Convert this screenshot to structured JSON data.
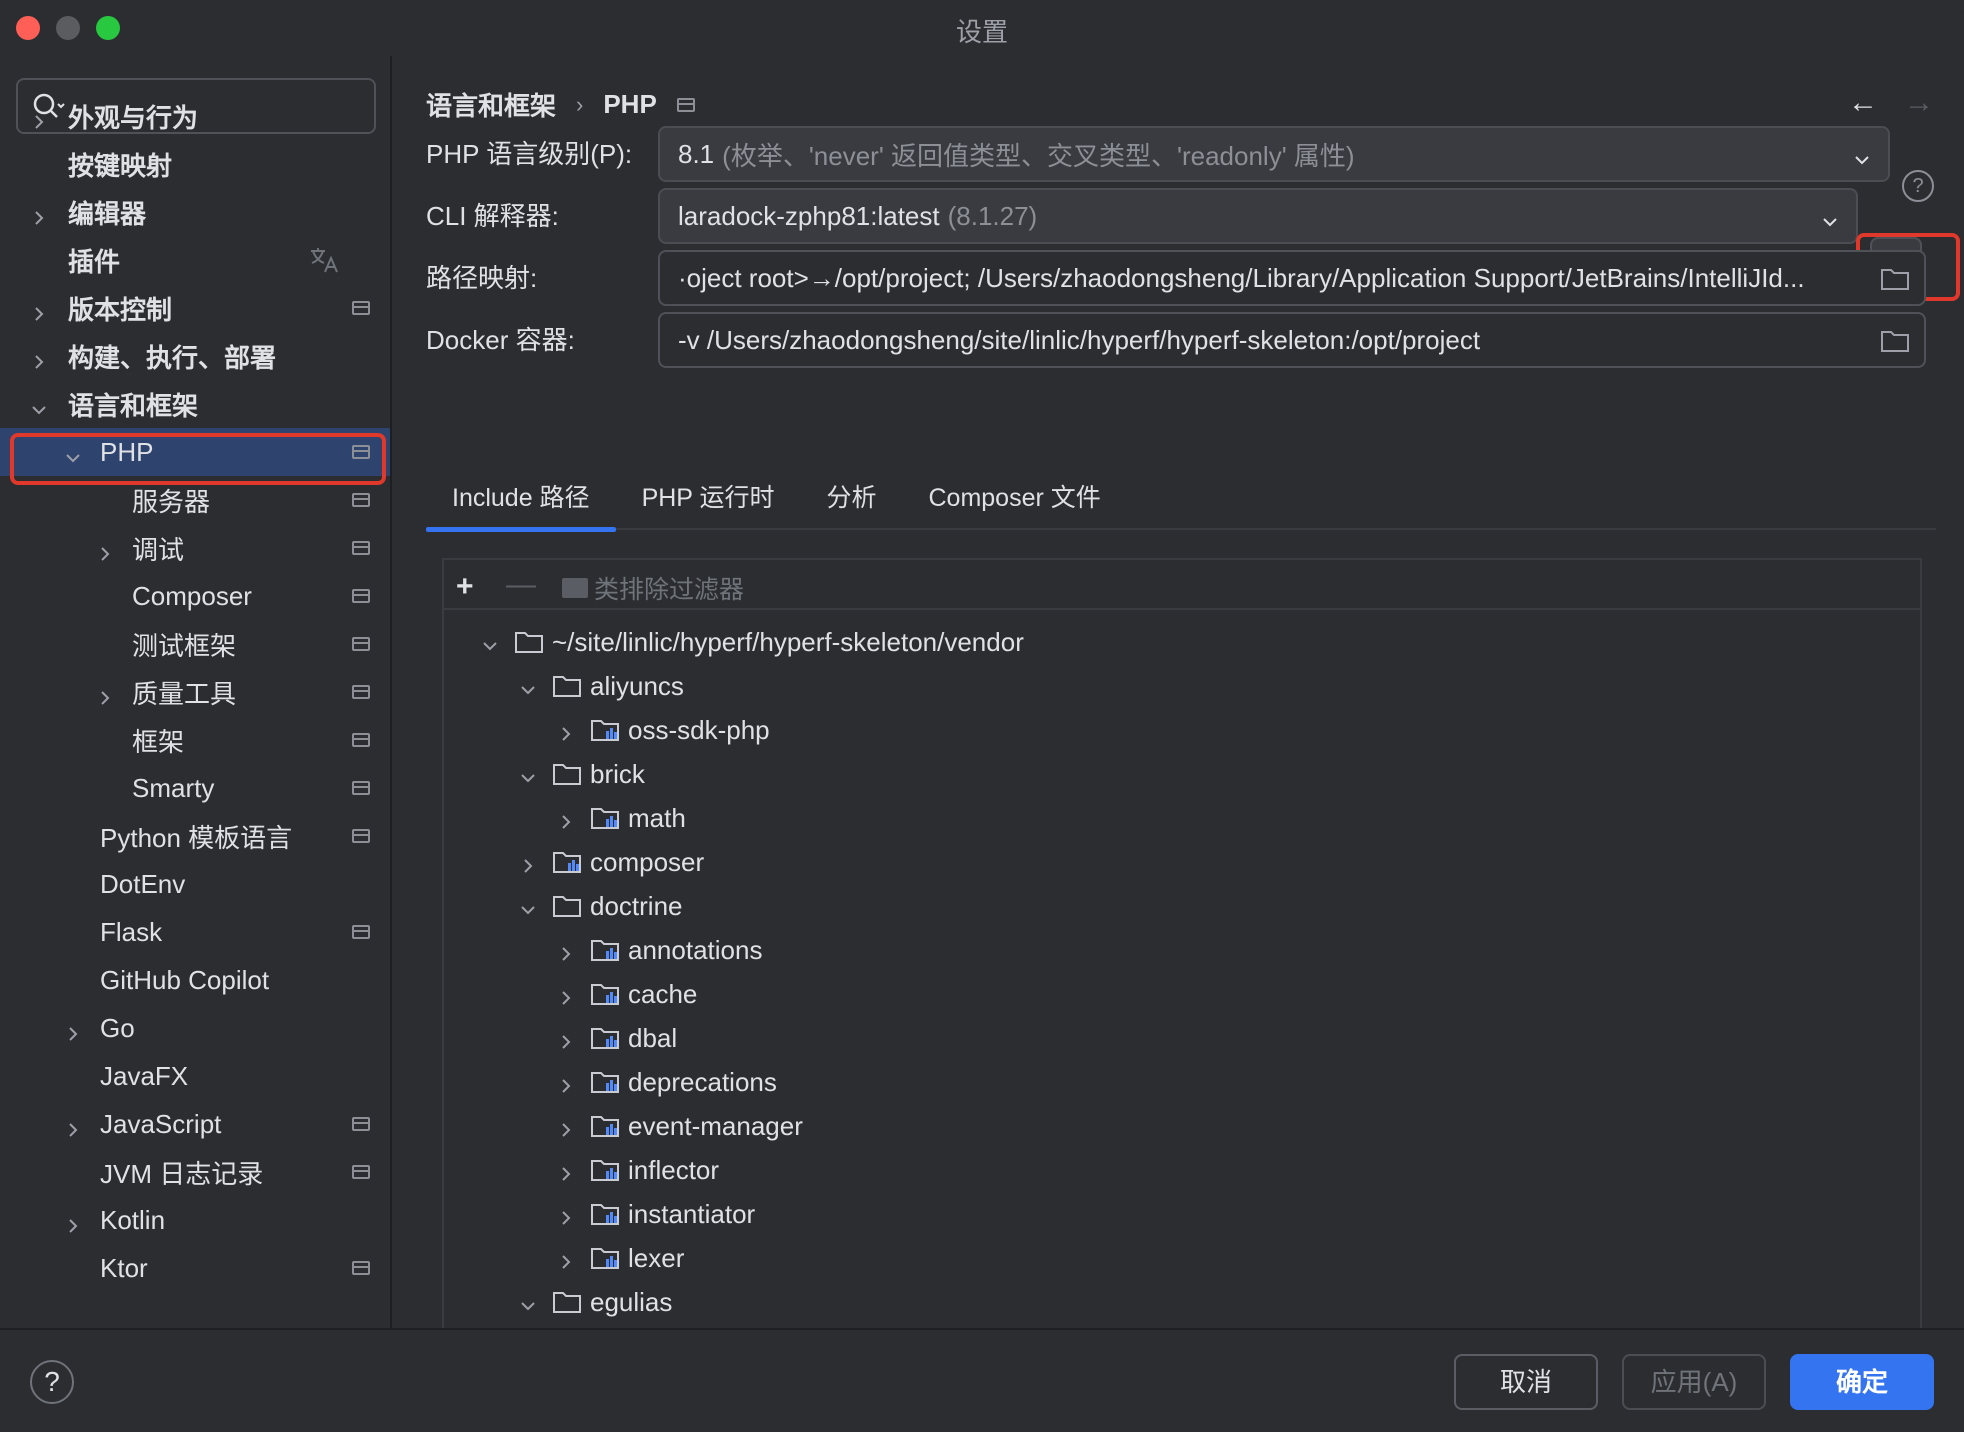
{
  "window": {
    "title": "设置"
  },
  "sidebar": {
    "search": {
      "placeholder": ""
    },
    "items": [
      {
        "label": "外观与行为",
        "bold": true
      },
      {
        "label": "按键映射",
        "bold": true
      },
      {
        "label": "编辑器",
        "bold": true
      },
      {
        "label": "插件",
        "bold": true
      },
      {
        "label": "版本控制",
        "bold": true
      },
      {
        "label": "构建、执行、部署",
        "bold": true
      },
      {
        "label": "语言和框架",
        "bold": true
      },
      {
        "label": "PHP",
        "bold": false
      },
      {
        "label": "服务器",
        "bold": false
      },
      {
        "label": "调试",
        "bold": false
      },
      {
        "label": "Composer",
        "bold": false
      },
      {
        "label": "测试框架",
        "bold": false
      },
      {
        "label": "质量工具",
        "bold": false
      },
      {
        "label": "框架",
        "bold": false
      },
      {
        "label": "Smarty",
        "bold": false
      },
      {
        "label": "Python 模板语言",
        "bold": false
      },
      {
        "label": "DotEnv",
        "bold": false
      },
      {
        "label": "Flask",
        "bold": false
      },
      {
        "label": "GitHub Copilot",
        "bold": false
      },
      {
        "label": "Go",
        "bold": false
      },
      {
        "label": "JavaFX",
        "bold": false
      },
      {
        "label": "JavaScript",
        "bold": false
      },
      {
        "label": "JVM 日志记录",
        "bold": false
      },
      {
        "label": "Kotlin",
        "bold": false
      },
      {
        "label": "Ktor",
        "bold": false
      }
    ]
  },
  "main": {
    "breadcrumb": {
      "parent": "语言和框架",
      "separator": "›",
      "current": "PHP"
    },
    "nav": {
      "back": "←",
      "forward": "→"
    },
    "php_level": {
      "label": "PHP 语言级别(P):",
      "value": "8.1",
      "detail": "(枚举、'never' 返回值类型、交叉类型、'readonly' 属性)"
    },
    "cli": {
      "label": "CLI 解释器:",
      "value": "laradock-zphp81:latest",
      "detail": "(8.1.27)",
      "more_button": "..."
    },
    "path_mapping": {
      "label": "路径映射:",
      "value": "·oject root>→/opt/project; /Users/zhaodongsheng/Library/Application Support/JetBrains/IntelliJId..."
    },
    "docker": {
      "label": "Docker 容器:",
      "value": "-v /Users/zhaodongsheng/site/linlic/hyperf/hyperf-skeleton:/opt/project"
    },
    "help": "?",
    "tabs": [
      {
        "label": "Include 路径",
        "active": true
      },
      {
        "label": "PHP 运行时",
        "active": false
      },
      {
        "label": "分析",
        "active": false
      },
      {
        "label": "Composer 文件",
        "active": false
      }
    ],
    "toolbar": {
      "add": "+",
      "remove": "—",
      "filter": "类排除过滤器"
    },
    "tree": [
      {
        "label": "~/site/linlic/hyperf/hyperf-skeleton/vendor",
        "expanded": true,
        "lib": false
      },
      {
        "label": "aliyuncs",
        "expanded": true,
        "lib": false
      },
      {
        "label": "oss-sdk-php",
        "expanded": false,
        "lib": true
      },
      {
        "label": "brick",
        "expanded": true,
        "lib": false
      },
      {
        "label": "math",
        "expanded": false,
        "lib": true
      },
      {
        "label": "composer",
        "expanded": false,
        "lib": true
      },
      {
        "label": "doctrine",
        "expanded": true,
        "lib": false
      },
      {
        "label": "annotations",
        "expanded": false,
        "lib": true
      },
      {
        "label": "cache",
        "expanded": false,
        "lib": true
      },
      {
        "label": "dbal",
        "expanded": false,
        "lib": true
      },
      {
        "label": "deprecations",
        "expanded": false,
        "lib": true
      },
      {
        "label": "event-manager",
        "expanded": false,
        "lib": true
      },
      {
        "label": "inflector",
        "expanded": false,
        "lib": true
      },
      {
        "label": "instantiator",
        "expanded": false,
        "lib": true
      },
      {
        "label": "lexer",
        "expanded": false,
        "lib": true
      },
      {
        "label": "egulias",
        "expanded": true,
        "lib": false
      }
    ]
  },
  "footer": {
    "help": "?",
    "cancel": "取消",
    "apply": "应用(A)",
    "ok": "确定"
  },
  "colors": {
    "accent": "#3574f0",
    "highlight_outline": "#e0392b",
    "selected_bg": "#2e436e"
  }
}
